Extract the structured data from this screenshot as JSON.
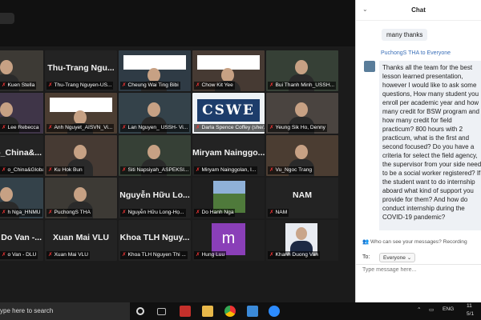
{
  "tiles": [
    {
      "name": "",
      "caption": "Kuen Stella",
      "kind": "video",
      "active": false
    },
    {
      "name": "Thu-Trang  Ngu...",
      "caption": "Thu-Trang Nguyen-US...",
      "kind": "name",
      "active": false
    },
    {
      "name": "",
      "caption": "Cheung Wai Ting Bibi",
      "kind": "slide",
      "active": false
    },
    {
      "name": "",
      "caption": "Chow Kit Yee",
      "kind": "slide",
      "active": false
    },
    {
      "name": "",
      "caption": "Bui Thanh Minh_USSH...",
      "kind": "video",
      "active": false
    },
    {
      "name": "",
      "caption": "Lee Rebecca",
      "kind": "video",
      "active": true
    },
    {
      "name": "",
      "caption": "Anh Nguyet_AISVN_Vi...",
      "kind": "slide",
      "active": false
    },
    {
      "name": "",
      "caption": "Lan Nguyen_ USSH- Vi...",
      "kind": "video",
      "active": false
    },
    {
      "name": "",
      "caption": "Darla Spence Coffey (she/...",
      "kind": "cswe",
      "active": false
    },
    {
      "name": "",
      "caption": "Yeung Sik Ho, Denny",
      "kind": "video",
      "active": false
    },
    {
      "name": "o_China&...",
      "caption": "o_China&Global...",
      "kind": "name",
      "active": false
    },
    {
      "name": "",
      "caption": "Ku Hok Bun",
      "kind": "video",
      "active": false
    },
    {
      "name": "",
      "caption": "Siti Napsiyah_ASPEKSI...",
      "kind": "video",
      "active": false
    },
    {
      "name": "Miryam  Nainggo...",
      "caption": "Miryam Nainggolan, I...",
      "kind": "name",
      "active": false
    },
    {
      "name": "",
      "caption": "Vu_Ngoc Trang",
      "kind": "video",
      "active": false
    },
    {
      "name": "",
      "caption": "h Nga_HNMU",
      "kind": "video",
      "active": false
    },
    {
      "name": "",
      "caption": "PuchongS THA",
      "kind": "video",
      "active": false
    },
    {
      "name": "Nguyễn  Hữu  Lo...",
      "caption": "Nguyễn Hữu Long-Họ...",
      "kind": "name",
      "active": false
    },
    {
      "name": "",
      "caption": "Do Hanh Nga",
      "kind": "landscape",
      "active": false
    },
    {
      "name": "NAM",
      "caption": "NAM",
      "kind": "name",
      "active": false
    },
    {
      "name": "Do  Van  -...",
      "caption": "o Van - DLU",
      "kind": "name",
      "active": false
    },
    {
      "name": "Xuan  Mai  VLU",
      "caption": "Xuan Mai VLU",
      "kind": "name",
      "active": false
    },
    {
      "name": "Khoa  TLH  Nguy...",
      "caption": "Khoa TLH Nguyen Thi ...",
      "kind": "name",
      "active": false
    },
    {
      "name": "",
      "caption": "Hung Luu",
      "kind": "m",
      "active": false
    },
    {
      "name": "",
      "caption": "Khanh Duong Van",
      "kind": "portrait",
      "active": false
    }
  ],
  "cswe_text": "CSWE",
  "m_letter": "m",
  "chat": {
    "title": "Chat",
    "prev_message": "many thanks",
    "sender_line": "PuchongS THA  to  Everyone",
    "message": "Thanks all the team for the best lesson learned presentation, however I would like to ask some questions, How many student you enroll per academic year and how many credit for BSW program and how many credit for field practicum? 800 hours with 2 practicum,  what is the first and second focused? Do you have a criteria for select the field agency, the supervisor from your side need to be a social worker registered? If the student want to do internship aboard what kind of support you provide for them?  And how do conduct internship during the COVID-19 pandemic?",
    "who_can_see": "Who can see your messages? Recording",
    "to_label": "To:",
    "to_value": "Everyone ⌄",
    "input_placeholder": "Type message here..."
  },
  "taskbar": {
    "search_text": "ype here to search",
    "lang": "ENG",
    "time": "11",
    "date": "5/1"
  },
  "colors": {
    "active_border": "#c6e24a",
    "muted_mic": "#e33333",
    "link_blue": "#3a6fb8"
  }
}
